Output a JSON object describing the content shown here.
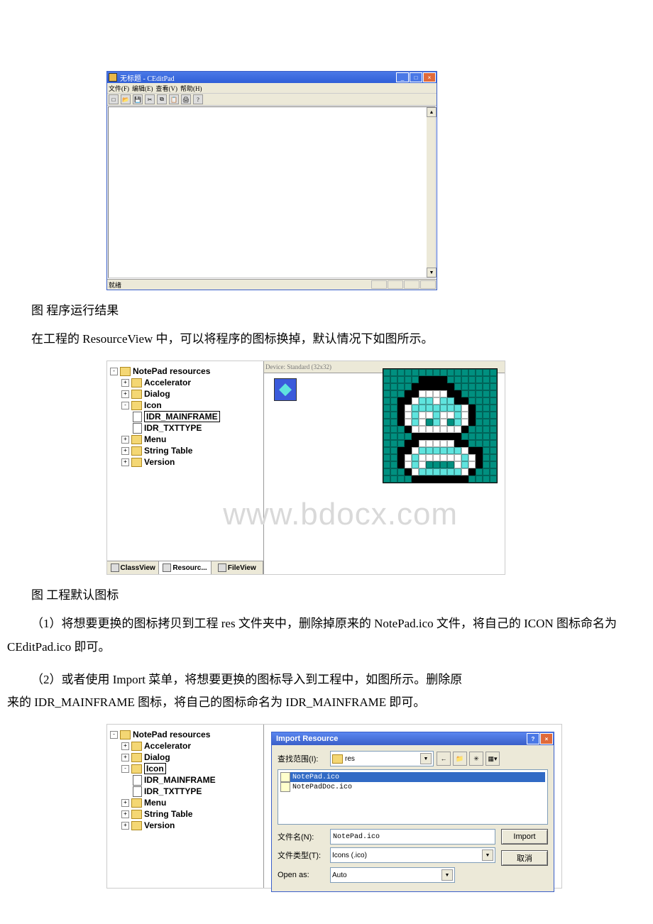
{
  "shot1": {
    "title": "无标题 - CEditPad",
    "menus": [
      "文件(F)",
      "编辑(E)",
      "查看(V)",
      "帮助(H)"
    ],
    "tools": [
      "new",
      "open",
      "save",
      "cut",
      "copy",
      "paste",
      "print",
      "help"
    ],
    "status": "就绪",
    "window_controls": {
      "min": "_",
      "max": "□",
      "close": "×"
    }
  },
  "caption1": "图 程序运行结果",
  "para1": "在工程的 ResourceView 中，可以将程序的图标换掉，默认情况下如图所示。",
  "shot2": {
    "root": "NotePad resources",
    "nodes": {
      "accel": "Accelerator",
      "dialog": "Dialog",
      "icon": "Icon",
      "mainframe": "IDR_MAINFRAME",
      "txttype": "IDR_TXTTYPE",
      "menu": "Menu",
      "string": "String Table",
      "version": "Version"
    },
    "tabs": {
      "class": "ClassView",
      "resource": "Resourc...",
      "file": "FileView"
    },
    "device_label": "Device:  Standard (32x32)",
    "watermark": "www.bdocx.com"
  },
  "caption2": "图 工程默认图标",
  "para2a": "（1）将想要更换的图标拷贝到工程 res 文件夹中，删除掉原来的 NotePad.ico 文件，将自己的 ICON 图标命名为 CEditPad.ico 即可。",
  "para2b_line1": "（2）或者使用 Import 菜单，将想要更换的图标导入到工程中，如图所示。删除原",
  "para2b_line2": "来的 IDR_MAINFRAME 图标，将自己的图标命名为 IDR_MAINFRAME 即可。",
  "shot3": {
    "dlg_title": "Import Resource",
    "lookin_label": "查找范围(I):",
    "lookin_value": "res",
    "nav": [
      "back",
      "up",
      "newfolder",
      "views"
    ],
    "files": [
      "NotePad.ico",
      "NotePadDoc.ico"
    ],
    "filename_label": "文件名(N):",
    "filename_value": "NotePad.ico",
    "filetype_label": "文件类型(T):",
    "filetype_value": "Icons (.ico)",
    "openas_label": "Open as:",
    "openas_value": "Auto",
    "import_btn": "Import",
    "cancel_btn": "取消",
    "help_btn": "?",
    "close_btn": "×"
  }
}
